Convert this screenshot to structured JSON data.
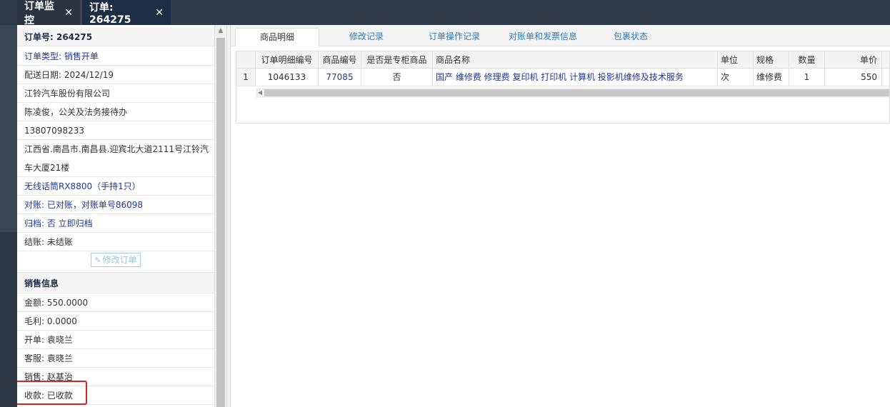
{
  "tabs": [
    {
      "label": "订单监控",
      "close": "✕"
    },
    {
      "label": "订单: 264275",
      "close": "✕"
    }
  ],
  "order": {
    "number_label": "订单号: 264275",
    "type": "订单类型: 销售开单",
    "delivery_date": "配送日期: 2024/12/19",
    "company": "江铃汽车股份有限公司",
    "contact": "陈凌俊，公关及法务接待办",
    "phone": "13807098233",
    "address_line1": "江西省.南昌市.南昌县.迎宾北大道2111号江铃汽",
    "address_line2": "车大厦21楼",
    "device": "无线话筒RX8800（手持1只）",
    "reconcile": "对账: 已对账，对账单号86098",
    "archive": "归档: 否 立即归档",
    "settle": "结账: 未结账",
    "edit_button": "修改订单"
  },
  "sales": {
    "header": "销售信息",
    "amount": "金额: 550.0000",
    "profit": "毛利: 0.0000",
    "opener": "开单: 袁晓兰",
    "service": "客服: 袁晓兰",
    "salesperson": "销售: 赵基治",
    "payment": "收款: 已收款"
  },
  "content_tabs": [
    "商品明细",
    "修改记录",
    "订单操作记录",
    "对账单和发票信息",
    "包裹状态"
  ],
  "grid": {
    "headers": [
      "",
      "订单明细编号",
      "商品编号",
      "是否是专柜商品",
      "商品名称",
      "单位",
      "规格",
      "数量",
      "单价"
    ],
    "rows": [
      [
        "1",
        "1046133",
        "77085",
        "否",
        "国产 维修费 修理费 复印机 打印机 计算机 投影机维修及技术服务",
        "次",
        "维修费",
        "1",
        "550"
      ]
    ]
  }
}
